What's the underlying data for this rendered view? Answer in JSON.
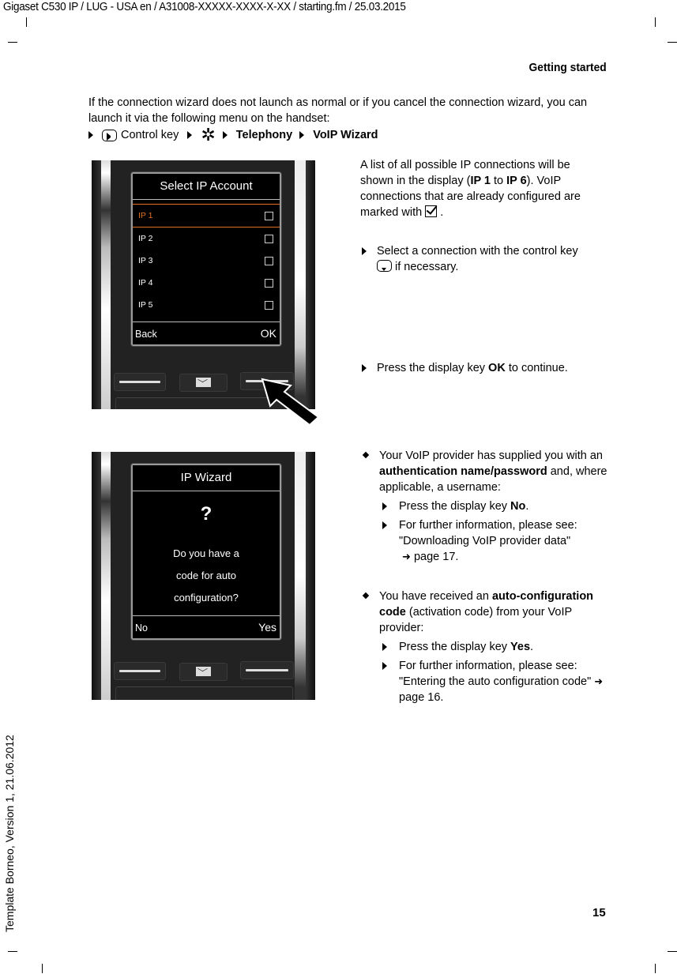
{
  "page_header": {
    "doc_line": "Gigaset C530 IP / LUG - USA en / A31008-XXXXX-XXXX-X-XX / starting.fm / 25.03.2015",
    "section_title": "Getting started",
    "side_template": "Template Borneo, Version 1, 21.06.2012",
    "page_number": "15"
  },
  "intro": {
    "text": "If the connection wizard does not launch as normal or if you cancel the connection wizard, you can launch it via the following menu on the handset:",
    "menu_path": {
      "control_key_icon": "control-key-icon",
      "control_key_label": "Control key",
      "settings_icon": "gear-icon",
      "step1": "Telephony",
      "step2": "VoIP Wizard"
    }
  },
  "screen1": {
    "title": "Select IP Account",
    "items": [
      {
        "label": "IP 1",
        "selected": true,
        "checked": false
      },
      {
        "label": "IP 2",
        "selected": false,
        "checked": false
      },
      {
        "label": "IP 3",
        "selected": false,
        "checked": false
      },
      {
        "label": "IP 4",
        "selected": false,
        "checked": false
      },
      {
        "label": "IP 5",
        "selected": false,
        "checked": false
      }
    ],
    "soft_left": "Back",
    "soft_right": "OK",
    "highlight_color": "#e07020"
  },
  "desc1": {
    "para_a": "A list of all possible IP connections will be shown in the display (",
    "para_b": "IP 1",
    "para_c": " to ",
    "para_d": "IP 6",
    "para_e": "). VoIP connections that are already configured are marked with",
    "para_f": " .",
    "step1_a": "Select a connection with the control key",
    "step1_b": " if necessary.",
    "step2_a": "Press the display key ",
    "step2_b": "OK",
    "step2_c": " to continue."
  },
  "screen2": {
    "title": "IP Wizard",
    "question_mark": "?",
    "lines": [
      "Do you have a",
      "code for auto",
      "configuration?"
    ],
    "soft_left": "No",
    "soft_right": "Yes"
  },
  "desc2": {
    "case1_a": "Your VoIP provider has supplied you with an ",
    "case1_b": "authentication name/password",
    "case1_c": " and, where applicable, a username:",
    "case1_step1_a": "Press the display key ",
    "case1_step1_b": "No",
    "case1_step1_c": ".",
    "case1_step2_a": "For further information, please see: \"Downloading VoIP provider data\"",
    "case1_step2_arrow": "➜",
    "case1_step2_b": " page 17.",
    "case2_a": "You have received an ",
    "case2_b": "auto-configuration code",
    "case2_c": " (activation code) from your VoIP provider:",
    "case2_step1_a": "Press the display key ",
    "case2_step1_b": "Yes",
    "case2_step1_c": ".",
    "case2_step2_a": "For further information, please see: \"Entering the auto configuration code\" ",
    "case2_step2_arrow": "➜",
    "case2_step2_b": " page 16."
  }
}
